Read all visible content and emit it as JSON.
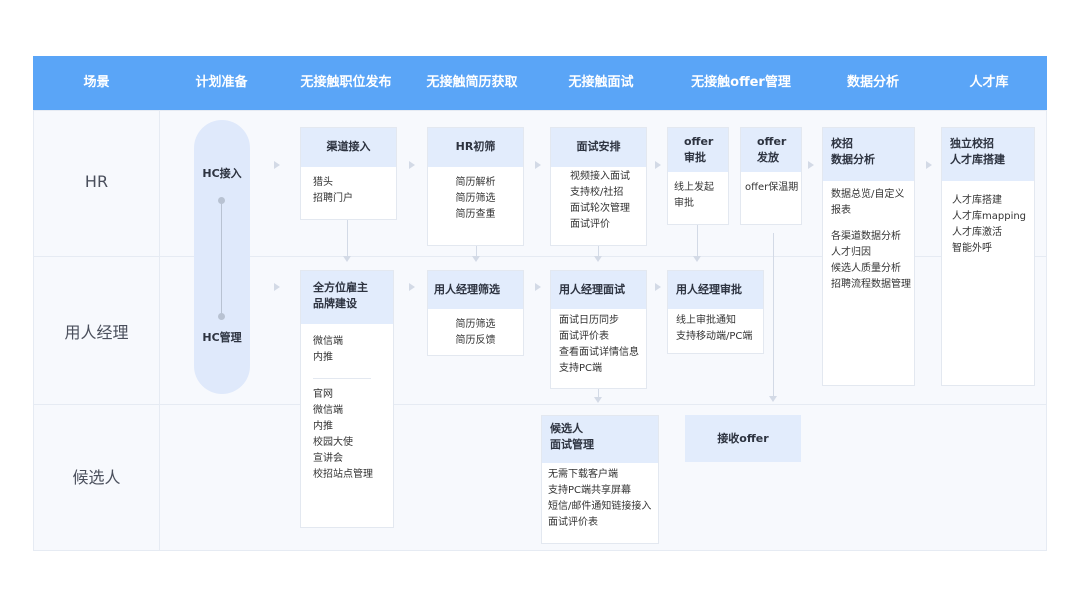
{
  "header": {
    "columns": [
      "场景",
      "计划准备",
      "无接触职位发布",
      "无接触简历获取",
      "无接触面试",
      "无接触offer管理",
      "数据分析",
      "人才库"
    ]
  },
  "lanes": {
    "hr": "HR",
    "manager": "用人经理",
    "candidate": "候选人"
  },
  "plan": {
    "hc_access": "HC接入",
    "hc_manage": "HC管理"
  },
  "cards": {
    "channel": {
      "title": "渠道接入",
      "items": [
        "猎头",
        "招聘门户"
      ]
    },
    "hr_screen": {
      "title": "HR初筛",
      "items": [
        "简历解析",
        "简历筛选",
        "简历查重"
      ]
    },
    "interview_arrange": {
      "title": "面试安排",
      "items": [
        "视频接入面试",
        "支持校/社招",
        "面试轮次管理",
        "面试评价"
      ]
    },
    "offer_approve": {
      "title_line1": "offer",
      "title_line2": "审批",
      "items": [
        "线上发起",
        "审批"
      ]
    },
    "offer_issue": {
      "title_line1": "offer",
      "title_line2": "发放",
      "items": [
        "offer保温期"
      ]
    },
    "campus_analysis": {
      "title_line1": "校招",
      "title_line2": "数据分析",
      "items_a": [
        "数据总览/自定义",
        "报表"
      ],
      "items_b": [
        "各渠道数据分析",
        "人才归因",
        "候选人质量分析",
        "招聘流程数据管理"
      ]
    },
    "talent_pool": {
      "title_line1": "独立校招",
      "title_line2": "人才库搭建",
      "items": [
        "人才库搭建",
        "人才库mapping",
        "人才库激活",
        "智能外呼"
      ]
    },
    "employer_brand": {
      "title_line1": "全方位雇主",
      "title_line2": "品牌建设",
      "items_a": [
        "微信端",
        "内推"
      ],
      "items_b": [
        "官网",
        "微信端",
        "内推",
        "校园大使",
        "宣讲会",
        "校招站点管理"
      ]
    },
    "manager_screen": {
      "title": "用人经理筛选",
      "items": [
        "简历筛选",
        "简历反馈"
      ]
    },
    "manager_interview": {
      "title": "用人经理面试",
      "items": [
        "面试日历同步",
        "面试评价表",
        "查看面试详情信息",
        "支持PC端"
      ]
    },
    "manager_approve": {
      "title": "用人经理审批",
      "items": [
        "线上审批通知",
        "支持移动端/PC端"
      ]
    },
    "candidate_interview": {
      "title_line1": "候选人",
      "title_line2": "面试管理",
      "items": [
        "无需下载客户端",
        "支持PC端共享屏幕",
        "短信/邮件通知链接接入",
        "面试评价表"
      ]
    },
    "receive_offer": {
      "title": "接收offer"
    }
  },
  "colors": {
    "header_bg": "#5aa5f7",
    "card_head_bg": "#e2ecfc",
    "lane_bg": "#f7f9fd",
    "connector": "#d3dae6"
  }
}
